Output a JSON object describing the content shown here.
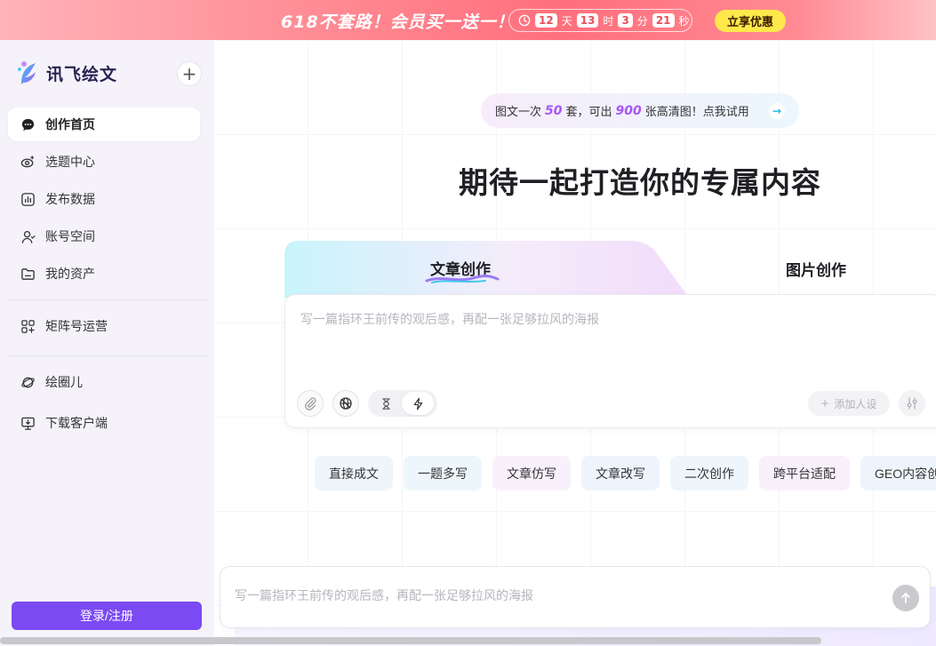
{
  "promo": {
    "title": "618不套路！会员买一送一！",
    "countdown": {
      "days": "12",
      "days_unit": "天",
      "hours": "13",
      "hours_unit": "时",
      "minutes": "3",
      "minutes_unit": "分",
      "seconds": "21",
      "seconds_unit": "秒"
    },
    "cta_label": "立享优惠"
  },
  "sidebar": {
    "logo_text": "讯飞绘文",
    "new_button_label": "+",
    "items": [
      {
        "label": "创作首页",
        "icon": "chat-bubble-icon",
        "active": true
      },
      {
        "label": "选题中心",
        "icon": "eye-spark-icon"
      },
      {
        "label": "发布数据",
        "icon": "bar-chart-icon"
      },
      {
        "label": "账号空间",
        "icon": "user-icon"
      },
      {
        "label": "我的资产",
        "icon": "folder-icon"
      },
      {
        "label": "矩阵号运营",
        "icon": "grid-icon"
      },
      {
        "label": "绘圈儿",
        "icon": "planet-icon"
      },
      {
        "label": "下载客户端",
        "icon": "monitor-download-icon"
      }
    ],
    "login_label": "登录/注册"
  },
  "main": {
    "tip": {
      "prefix": "图文一次",
      "num1": "50",
      "mid": "套，可出",
      "num2": "900",
      "suffix": "张高清图！点我试用",
      "arrow": "→"
    },
    "headline": "期待一起打造你的专属内容",
    "tabs": [
      {
        "label": "文章创作",
        "active": true
      },
      {
        "label": "图片创作"
      }
    ],
    "composer": {
      "placeholder": "写一篇指环王前传的观后感，再配一张足够拉风的海报",
      "persona_label": "添加人设"
    },
    "chips": [
      "直接成文",
      "一题多写",
      "文章仿写",
      "文章改写",
      "二次创作",
      "跨平台适配",
      "GEO内容创作"
    ],
    "bottom_input": {
      "placeholder": "写一篇指环王前传的观后感，再配一张足够拉风的海报"
    }
  },
  "colors": {
    "accent": "#7b4af2",
    "promo_red": "#ff6f7c",
    "promo_cta": "#ffe84a",
    "highlight_purple": "#a855f7"
  }
}
